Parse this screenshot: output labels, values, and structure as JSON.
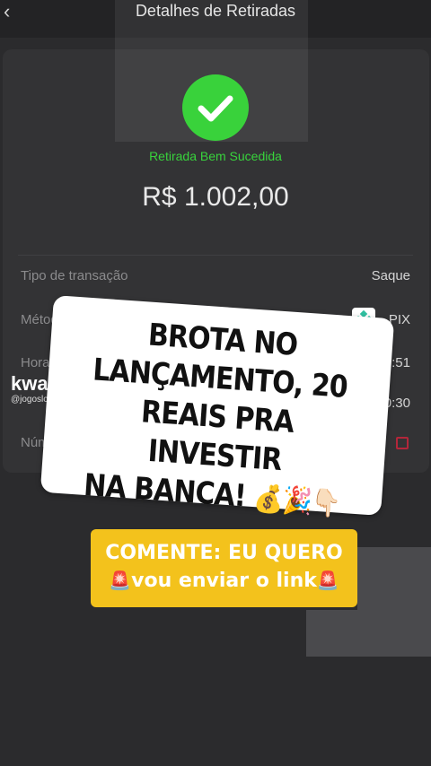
{
  "header": {
    "back_symbol": "‹",
    "title": "Detalhes de Retiradas"
  },
  "receipt": {
    "status": "Retirada Bem Sucedida",
    "amount": "R$ 1.002,00",
    "rows": [
      {
        "label": "Tipo de transação",
        "value": "Saque"
      },
      {
        "label": "Método de Retirad",
        "value": "PIX"
      },
      {
        "label": "Hora de C",
        "value": "06:51"
      },
      {
        "label": "",
        "value": "10:30"
      },
      {
        "label": "Núm",
        "value": ""
      }
    ]
  },
  "watermark": {
    "logo": "kwai",
    "handle": "@jogoslcaso"
  },
  "sticker": {
    "lines": [
      "BROTA NO",
      "LANÇAMENTO, 20",
      "REAIS PRA INVESTIR",
      "NA BANCA!"
    ],
    "emojis": "💰🎉👇🏻"
  },
  "cta": {
    "line1": "COMENTE: EU QUERO",
    "line2_prefix": "🚨",
    "line2_text": "vou enviar o link",
    "line2_suffix": "🚨"
  },
  "colors": {
    "background": "#2b2b2d",
    "success": "#39d23b",
    "cta_yellow": "#f3c21c"
  },
  "icons": {
    "back": "chevron-left-icon",
    "status": "checkmark-circle-icon",
    "method": "pix-icon"
  }
}
